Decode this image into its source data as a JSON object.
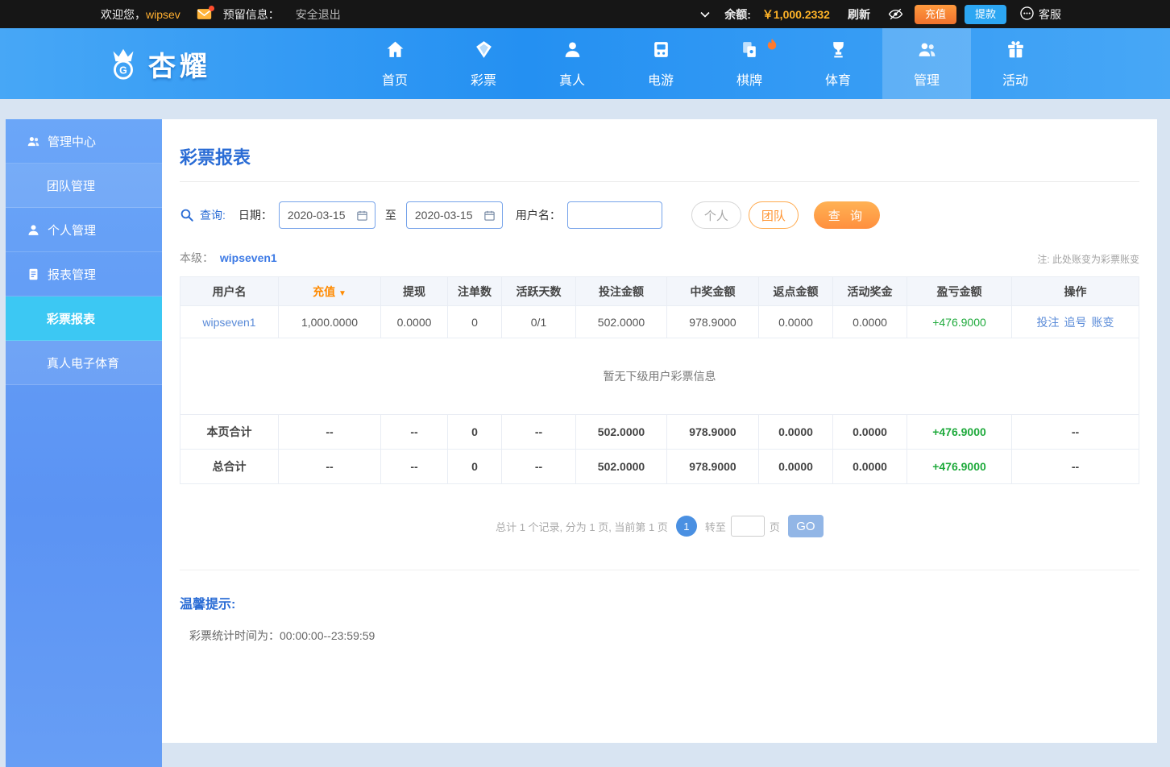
{
  "topbar": {
    "welcome_prefix": "欢迎您，",
    "username": "wipsev",
    "reserved_label": "预留信息：",
    "logout_label": "安全退出",
    "balance_label": "余额:",
    "balance_value": "￥1,000.2332",
    "refresh_label": "刷新",
    "recharge_label": "充值",
    "withdraw_label": "提款",
    "service_label": "客服"
  },
  "nav": {
    "logo_text": "杏耀",
    "items": [
      {
        "label": "首页"
      },
      {
        "label": "彩票"
      },
      {
        "label": "真人"
      },
      {
        "label": "电游"
      },
      {
        "label": "棋牌"
      },
      {
        "label": "体育"
      },
      {
        "label": "管理"
      },
      {
        "label": "活动"
      }
    ]
  },
  "sidebar": {
    "items": [
      {
        "label": "管理中心"
      },
      {
        "label": "团队管理"
      },
      {
        "label": "个人管理"
      },
      {
        "label": "报表管理"
      },
      {
        "label": "彩票报表"
      },
      {
        "label": "真人电子体育"
      }
    ]
  },
  "main": {
    "title": "彩票报表",
    "search": {
      "query_label": "查询:",
      "date_label": "日期：",
      "date_from": "2020-03-15",
      "to_label": "至",
      "date_to": "2020-03-15",
      "username_label": "用户名：",
      "username_value": "",
      "personal_btn": "个人",
      "team_btn": "团队",
      "search_btn": "查 询"
    },
    "level_label": "本级：",
    "level_user": "wipseven1",
    "note": "注: 此处账变为彩票账变",
    "table": {
      "headers": [
        "用户名",
        "充值",
        "提现",
        "注单数",
        "活跃天数",
        "投注金额",
        "中奖金额",
        "返点金额",
        "活动奖金",
        "盈亏金额",
        "操作"
      ],
      "sort_icon": "▼",
      "row": {
        "username": "wipseven1",
        "values": [
          "1,000.0000",
          "0.0000",
          "0",
          "0/1",
          "502.0000",
          "978.9000",
          "0.0000",
          "0.0000"
        ],
        "profit": "+476.9000",
        "actions": [
          "投注",
          "追号",
          "账变"
        ]
      },
      "empty_text": "暂无下级用户彩票信息",
      "page_total": {
        "label": "本页合计",
        "values": [
          "--",
          "--",
          "0",
          "--",
          "502.0000",
          "978.9000",
          "0.0000",
          "0.0000"
        ],
        "profit": "+476.9000",
        "actions_placeholder": "--"
      },
      "grand_total": {
        "label": "总合计",
        "values": [
          "--",
          "--",
          "0",
          "--",
          "502.0000",
          "978.9000",
          "0.0000",
          "0.0000"
        ],
        "profit": "+476.9000",
        "actions_placeholder": "--"
      }
    },
    "pagination": {
      "summary": "总计 1 个记录, 分为 1 页, 当前第 1 页",
      "current_page": "1",
      "goto_label": "转至",
      "page_unit": "页",
      "go_label": "GO"
    },
    "tips": {
      "title": "温馨提示:",
      "content": "彩票统计时间为：00:00:00--23:59:59"
    }
  }
}
